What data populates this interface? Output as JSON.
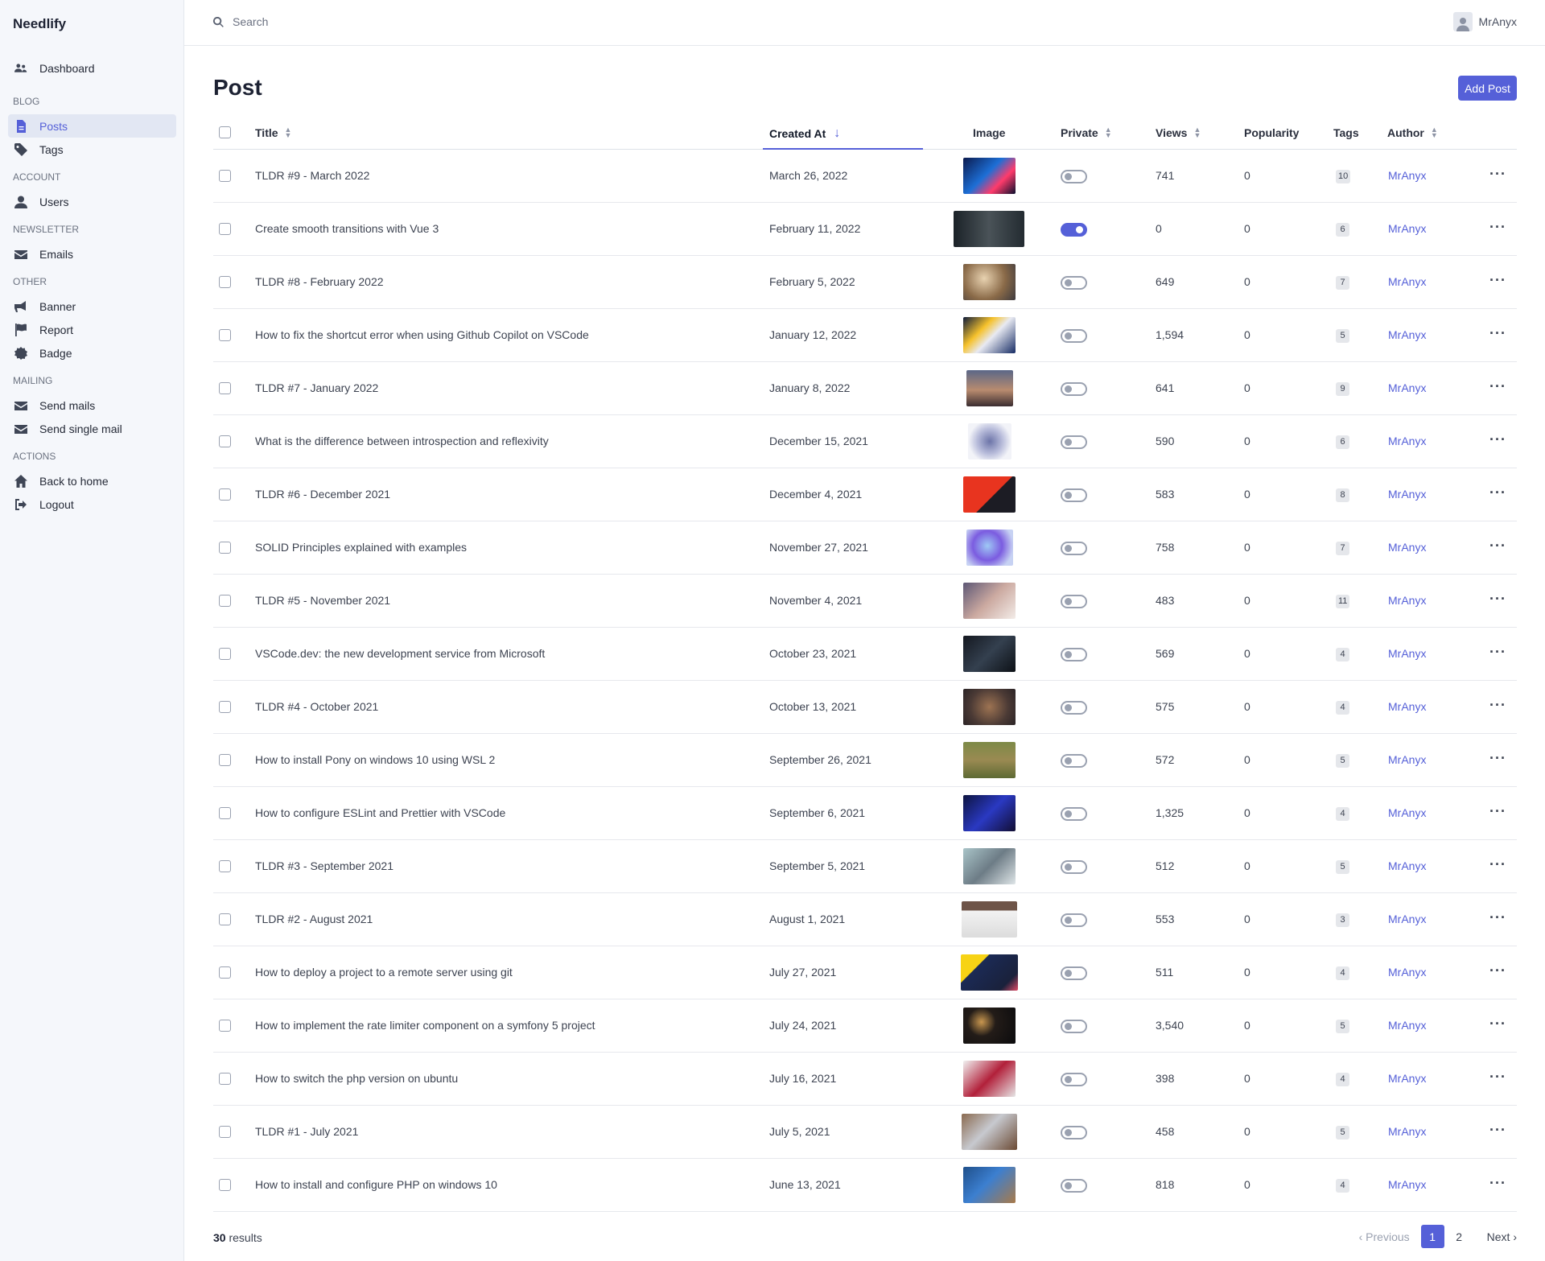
{
  "app": {
    "name": "Needlify"
  },
  "sidebar": {
    "dashboard": "Dashboard",
    "sections": [
      {
        "title": "BLOG",
        "items": [
          {
            "label": "Posts",
            "icon": "file-icon",
            "active": true
          },
          {
            "label": "Tags",
            "icon": "tag-icon"
          }
        ]
      },
      {
        "title": "ACCOUNT",
        "items": [
          {
            "label": "Users",
            "icon": "user-icon"
          }
        ]
      },
      {
        "title": "NEWSLETTER",
        "items": [
          {
            "label": "Emails",
            "icon": "envelope-icon"
          }
        ]
      },
      {
        "title": "OTHER",
        "items": [
          {
            "label": "Banner",
            "icon": "megaphone-icon"
          },
          {
            "label": "Report",
            "icon": "flag-icon"
          },
          {
            "label": "Badge",
            "icon": "badge-icon"
          }
        ]
      },
      {
        "title": "MAILING",
        "items": [
          {
            "label": "Send mails",
            "icon": "envelope-icon"
          },
          {
            "label": "Send single mail",
            "icon": "envelope-icon"
          }
        ]
      },
      {
        "title": "ACTIONS",
        "items": [
          {
            "label": "Back to home",
            "icon": "home-icon"
          },
          {
            "label": "Logout",
            "icon": "logout-icon"
          }
        ]
      }
    ]
  },
  "topbar": {
    "search_placeholder": "Search",
    "user_name": "MrAnyx"
  },
  "page": {
    "title": "Post",
    "add_button": "Add Post"
  },
  "table": {
    "columns": {
      "title": "Title",
      "created_at": "Created At",
      "image": "Image",
      "private": "Private",
      "views": "Views",
      "popularity": "Popularity",
      "tags": "Tags",
      "author": "Author"
    },
    "rows": [
      {
        "title": "TLDR #9 - March 2022",
        "created": "March 26, 2022",
        "private": false,
        "views": "741",
        "popularity": "0",
        "tags": "10",
        "author": "MrAnyx"
      },
      {
        "title": "Create smooth transitions with Vue 3",
        "created": "February 11, 2022",
        "private": true,
        "views": "0",
        "popularity": "0",
        "tags": "6",
        "author": "MrAnyx"
      },
      {
        "title": "TLDR #8 - February 2022",
        "created": "February 5, 2022",
        "private": false,
        "views": "649",
        "popularity": "0",
        "tags": "7",
        "author": "MrAnyx"
      },
      {
        "title": "How to fix the shortcut error when using Github Copilot on VSCode",
        "created": "January 12, 2022",
        "private": false,
        "views": "1,594",
        "popularity": "0",
        "tags": "5",
        "author": "MrAnyx"
      },
      {
        "title": "TLDR #7 - January 2022",
        "created": "January 8, 2022",
        "private": false,
        "views": "641",
        "popularity": "0",
        "tags": "9",
        "author": "MrAnyx"
      },
      {
        "title": "What is the difference between introspection and reflexivity",
        "created": "December 15, 2021",
        "private": false,
        "views": "590",
        "popularity": "0",
        "tags": "6",
        "author": "MrAnyx"
      },
      {
        "title": "TLDR #6 - December 2021",
        "created": "December 4, 2021",
        "private": false,
        "views": "583",
        "popularity": "0",
        "tags": "8",
        "author": "MrAnyx"
      },
      {
        "title": "SOLID Principles explained with examples",
        "created": "November 27, 2021",
        "private": false,
        "views": "758",
        "popularity": "0",
        "tags": "7",
        "author": "MrAnyx"
      },
      {
        "title": "TLDR #5 - November 2021",
        "created": "November 4, 2021",
        "private": false,
        "views": "483",
        "popularity": "0",
        "tags": "11",
        "author": "MrAnyx"
      },
      {
        "title": "VSCode.dev: the new development service from Microsoft",
        "created": "October 23, 2021",
        "private": false,
        "views": "569",
        "popularity": "0",
        "tags": "4",
        "author": "MrAnyx"
      },
      {
        "title": "TLDR #4 - October 2021",
        "created": "October 13, 2021",
        "private": false,
        "views": "575",
        "popularity": "0",
        "tags": "4",
        "author": "MrAnyx"
      },
      {
        "title": "How to install Pony on windows 10 using WSL 2",
        "created": "September 26, 2021",
        "private": false,
        "views": "572",
        "popularity": "0",
        "tags": "5",
        "author": "MrAnyx"
      },
      {
        "title": "How to configure ESLint and Prettier with VSCode",
        "created": "September 6, 2021",
        "private": false,
        "views": "1,325",
        "popularity": "0",
        "tags": "4",
        "author": "MrAnyx"
      },
      {
        "title": "TLDR #3 - September 2021",
        "created": "September 5, 2021",
        "private": false,
        "views": "512",
        "popularity": "0",
        "tags": "5",
        "author": "MrAnyx"
      },
      {
        "title": "TLDR #2 - August 2021",
        "created": "August 1, 2021",
        "private": false,
        "views": "553",
        "popularity": "0",
        "tags": "3",
        "author": "MrAnyx"
      },
      {
        "title": "How to deploy a project to a remote server using git",
        "created": "July 27, 2021",
        "private": false,
        "views": "511",
        "popularity": "0",
        "tags": "4",
        "author": "MrAnyx"
      },
      {
        "title": "How to implement the rate limiter component on a symfony 5 project",
        "created": "July 24, 2021",
        "private": false,
        "views": "3,540",
        "popularity": "0",
        "tags": "5",
        "author": "MrAnyx"
      },
      {
        "title": "How to switch the php version on ubuntu",
        "created": "July 16, 2021",
        "private": false,
        "views": "398",
        "popularity": "0",
        "tags": "4",
        "author": "MrAnyx"
      },
      {
        "title": "TLDR #1 - July 2021",
        "created": "July 5, 2021",
        "private": false,
        "views": "458",
        "popularity": "0",
        "tags": "5",
        "author": "MrAnyx"
      },
      {
        "title": "How to install and configure PHP on windows 10",
        "created": "June 13, 2021",
        "private": false,
        "views": "818",
        "popularity": "0",
        "tags": "4",
        "author": "MrAnyx"
      }
    ]
  },
  "footer": {
    "results_count": "30",
    "results_label": "results",
    "previous": "Previous",
    "pages": [
      "1",
      "2"
    ],
    "current_page": "1",
    "next": "Next"
  },
  "colors": {
    "accent": "#5560d8",
    "sidebar_bg": "#f5f7fb"
  }
}
